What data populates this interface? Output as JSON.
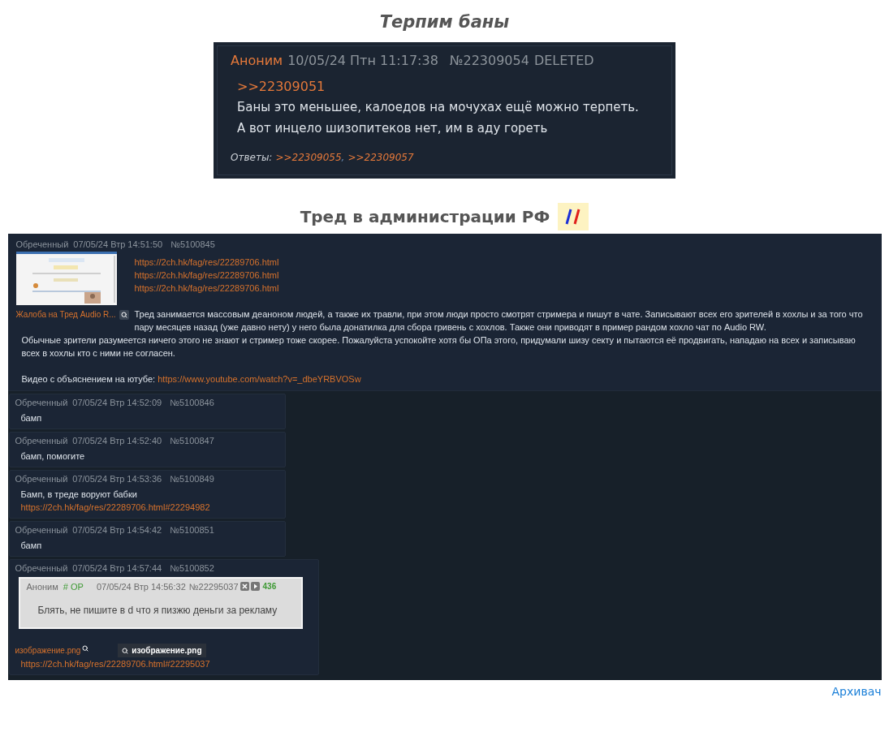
{
  "title": "Терпим баны",
  "quoted_post": {
    "name": "Аноним",
    "date": "10/05/24 Птн 11:17:38",
    "number": "№22309054",
    "status": "DELETED",
    "reply_link": ">>22309051",
    "lines": [
      "Баны это меньшее, калоедов на мочухах ещё можно терпеть.",
      "А вот инцело шизопитеков нет, им в аду гореть"
    ],
    "answers_label": "Ответы:",
    "answers": [
      ">>22309055",
      ">>22309057"
    ],
    "answers_separator": ","
  },
  "thread_title": "Тред в администрации РФ",
  "thread": {
    "op": {
      "name": "Обреченный",
      "date": "07/05/24 Втр 14:51:50",
      "number": "№5100845",
      "thumb_caption": "Жалоба на Тред Audio R...",
      "links": [
        "https://2ch.hk/fag/res/22289706.html",
        "https://2ch.hk/fag/res/22289706.html",
        "https://2ch.hk/fag/res/22289706.html"
      ],
      "lead": "Тред занимается массовым деаноном людей, а также их травли, при этом люди просто смотрят стримера и пишут в чате. Записывают всех его зрителей в хохлы и за того что пару месяцев назад (уже давно нету) у него была донатилка для сбора гривень с хохлов. Также они приводят в пример рандом хохло чат по Audio RW.",
      "paragraph": "Обычные зрители разумеется ничего этого не знают и стример тоже скорее. Пожалуйста успокойте хотя бы ОПа этого, придумали шизу секту и пытаются её продвигать, нападаю на всех и записываю всех в хохлы кто с ними не согласен.",
      "video_label": "Видео с объяснением на ютубе:",
      "video_link": "https://www.youtube.com/watch?v=_dbeYRBVOSw"
    },
    "replies": [
      {
        "name": "Обреченный",
        "date": "07/05/24 Втр 14:52:09",
        "number": "№5100846",
        "blocks": [
          {
            "kind": "text",
            "text": "бамп"
          }
        ]
      },
      {
        "name": "Обреченный",
        "date": "07/05/24 Втр 14:52:40",
        "number": "№5100847",
        "blocks": [
          {
            "kind": "text",
            "text": "бамп, помогите"
          }
        ]
      },
      {
        "name": "Обреченный",
        "date": "07/05/24 Втр 14:53:36",
        "number": "№5100849",
        "blocks": [
          {
            "kind": "text",
            "text": "Бамп, в треде воруют бабки"
          },
          {
            "kind": "link",
            "text": "https://2ch.hk/fag/res/22289706.html#22294982"
          }
        ]
      },
      {
        "name": "Обреченный",
        "date": "07/05/24 Втр 14:54:42",
        "number": "№5100851",
        "blocks": [
          {
            "kind": "text",
            "text": "бамп"
          }
        ]
      },
      {
        "name": "Обреченный",
        "date": "07/05/24 Втр 14:57:44",
        "number": "№5100852",
        "blocks": [
          {
            "kind": "embed",
            "name": "Аноним",
            "tripcode": "# OP",
            "date": "07/05/24 Втр 14:56:32",
            "number": "№22295037",
            "count": "436",
            "text": "Блять, не пишите в d что я пизжю деньги за рекламу"
          },
          {
            "kind": "files",
            "file_link": "изображение.png",
            "badge": "изображение.png"
          },
          {
            "kind": "link",
            "text": "https://2ch.hk/fag/res/22289706.html#22295037"
          }
        ]
      }
    ]
  },
  "footer_link": "Архивач"
}
